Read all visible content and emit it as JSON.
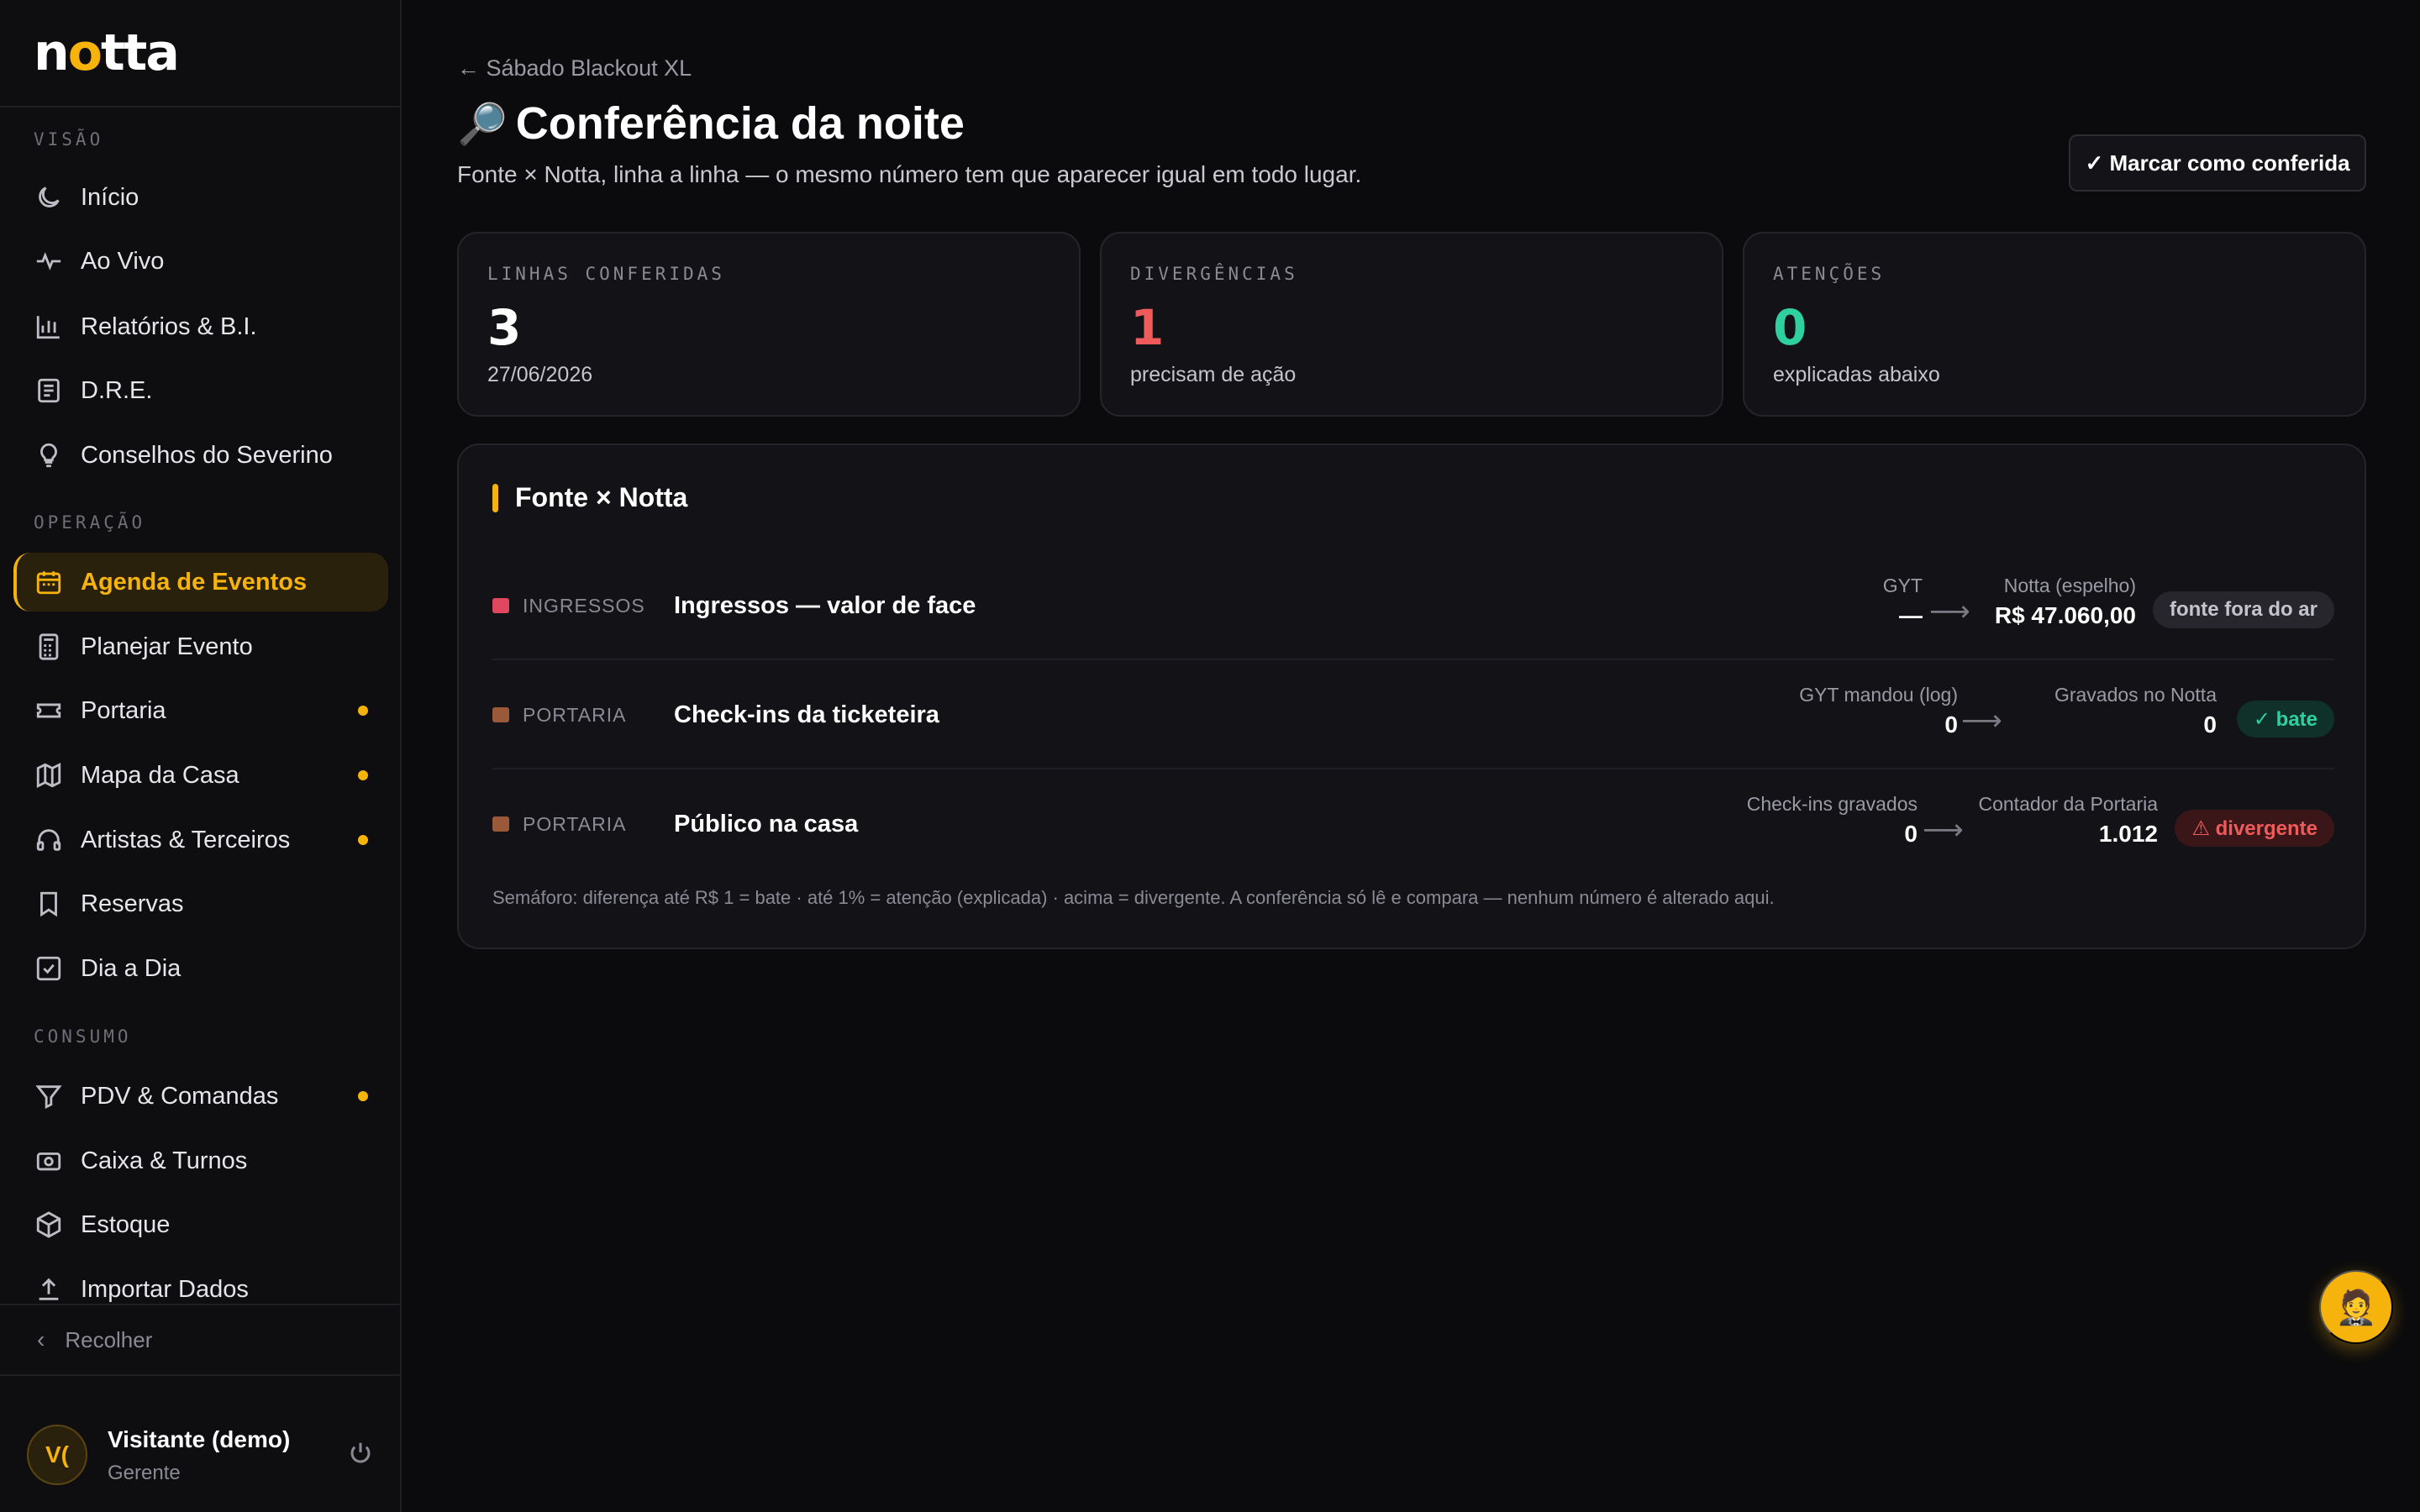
{
  "brand": {
    "logo_text_pre": "n",
    "logo_text_o": "o",
    "logo_text_post": "tta"
  },
  "sidebar": {
    "sections": [
      {
        "label": "VISÃO"
      },
      {
        "label": "OPERAÇÃO"
      },
      {
        "label": "CONSUMO"
      }
    ],
    "items": [
      {
        "label": "Início",
        "icon": "moon-icon"
      },
      {
        "label": "Ao Vivo",
        "icon": "pulse-icon"
      },
      {
        "label": "Relatórios & B.I.",
        "icon": "bar-chart-icon"
      },
      {
        "label": "D.R.E.",
        "icon": "document-icon"
      },
      {
        "label": "Conselhos do Severino",
        "icon": "lightbulb-icon"
      },
      {
        "label": "Agenda de Eventos",
        "icon": "calendar-icon",
        "active": true
      },
      {
        "label": "Planejar Evento",
        "icon": "calculator-icon"
      },
      {
        "label": "Portaria",
        "icon": "ticket-icon",
        "dot": true
      },
      {
        "label": "Mapa da Casa",
        "icon": "map-icon",
        "dot": true
      },
      {
        "label": "Artistas & Terceiros",
        "icon": "headphones-icon",
        "dot": true
      },
      {
        "label": "Reservas",
        "icon": "bookmark-icon"
      },
      {
        "label": "Dia a Dia",
        "icon": "checkbox-icon"
      },
      {
        "label": "PDV & Comandas",
        "icon": "funnel-icon",
        "dot": true
      },
      {
        "label": "Caixa & Turnos",
        "icon": "cash-register-icon"
      },
      {
        "label": "Estoque",
        "icon": "box-icon"
      },
      {
        "label": "Importar Dados",
        "icon": "upload-icon"
      }
    ],
    "collapse_label": "Recolher",
    "user": {
      "initials": "V(",
      "name": "Visitante (demo)",
      "role": "Gerente"
    }
  },
  "header": {
    "back_label": "← Sábado Blackout XL",
    "title_emoji": "🔎",
    "title": "Conferência da noite",
    "subtitle": "Fonte × Notta, linha a linha — o mesmo número tem que aparecer igual em todo lugar.",
    "mark_button": "✓ Marcar como conferida"
  },
  "stats": [
    {
      "label": "LINHAS CONFERIDAS",
      "value": "3",
      "sub": "27/06/2026",
      "tone": "neutral"
    },
    {
      "label": "DIVERGÊNCIAS",
      "value": "1",
      "sub": "precisam de ação",
      "tone": "red"
    },
    {
      "label": "ATENÇÕES",
      "value": "0",
      "sub": "explicadas abaixo",
      "tone": "green"
    }
  ],
  "panel": {
    "title": "Fonte × Notta",
    "rows": [
      {
        "category": "INGRESSOS",
        "cat_color": "#e0485f",
        "label": "Ingressos — valor de face",
        "src_label": "GYT",
        "src_value": "—",
        "dst_label": "Notta (espelho)",
        "dst_value": "R$ 47.060,00",
        "badge": "fonte fora do ar",
        "badge_tone": "gray"
      },
      {
        "category": "PORTARIA",
        "cat_color": "#9a5a3a",
        "label": "Check-ins da ticketeira",
        "src_label": "GYT mandou (log)",
        "src_value": "0",
        "dst_label": "Gravados no Notta",
        "dst_value": "0",
        "badge": "✓ bate",
        "badge_tone": "green"
      },
      {
        "category": "PORTARIA",
        "cat_color": "#9a5a3a",
        "label": "Público na casa",
        "src_label": "Check-ins gravados",
        "src_value": "0",
        "dst_label": "Contador da Portaria",
        "dst_value": "1.012",
        "badge": "⚠ divergente",
        "badge_tone": "red"
      }
    ],
    "arrow": "⟶",
    "footnote": "Semáforo: diferença até R$ 1 = bate · até 1% = atenção (explicada) · acima = divergente. A conferência só lê e compara — nenhum número é alterado aqui."
  },
  "fab": {
    "emoji": "🤵"
  }
}
